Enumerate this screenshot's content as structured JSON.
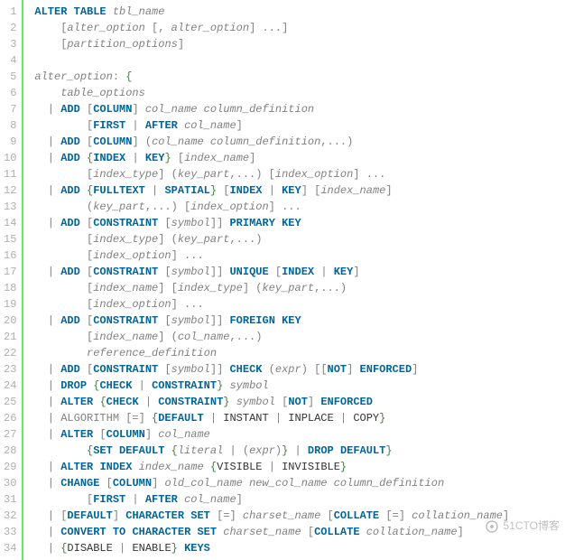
{
  "watermark": "51CTO博客",
  "lines": {
    "l1": [
      [
        "kw",
        "ALTER"
      ],
      [
        "p",
        " "
      ],
      [
        "kw",
        "TABLE"
      ],
      [
        "p",
        " "
      ],
      [
        "ar",
        "tbl_name"
      ]
    ],
    "l2": [
      [
        "p",
        "    ["
      ],
      [
        "ar",
        "alter_option"
      ],
      [
        "p",
        " [, "
      ],
      [
        "ar",
        "alter_option"
      ],
      [
        "p",
        "] ...]"
      ]
    ],
    "l3": [
      [
        "p",
        "    ["
      ],
      [
        "ar",
        "partition_options"
      ],
      [
        "p",
        "]"
      ]
    ],
    "l4": [
      [
        "p",
        ""
      ]
    ],
    "l5": [
      [
        "ar",
        "alter_option"
      ],
      [
        "p",
        ": "
      ],
      [
        "g",
        "{"
      ]
    ],
    "l6": [
      [
        "p",
        "    "
      ],
      [
        "ar",
        "table_options"
      ]
    ],
    "l7": [
      [
        "p",
        "  | "
      ],
      [
        "kw",
        "ADD"
      ],
      [
        "p",
        " ["
      ],
      [
        "kw",
        "COLUMN"
      ],
      [
        "p",
        "] "
      ],
      [
        "ar",
        "col_name"
      ],
      [
        "p",
        " "
      ],
      [
        "ar",
        "column_definition"
      ]
    ],
    "l8": [
      [
        "p",
        "        ["
      ],
      [
        "kw",
        "FIRST"
      ],
      [
        "p",
        " | "
      ],
      [
        "kw",
        "AFTER"
      ],
      [
        "p",
        " "
      ],
      [
        "ar",
        "col_name"
      ],
      [
        "p",
        "]"
      ]
    ],
    "l9": [
      [
        "p",
        "  | "
      ],
      [
        "kw",
        "ADD"
      ],
      [
        "p",
        " ["
      ],
      [
        "kw",
        "COLUMN"
      ],
      [
        "p",
        "] ("
      ],
      [
        "ar",
        "col_name"
      ],
      [
        "p",
        " "
      ],
      [
        "ar",
        "column_definition"
      ],
      [
        "p",
        ",...)"
      ]
    ],
    "l10": [
      [
        "p",
        "  | "
      ],
      [
        "kw",
        "ADD"
      ],
      [
        "p",
        " "
      ],
      [
        "g",
        "{"
      ],
      [
        "kw",
        "INDEX"
      ],
      [
        "p",
        " | "
      ],
      [
        "kw",
        "KEY"
      ],
      [
        "g",
        "}"
      ],
      [
        "p",
        " ["
      ],
      [
        "ar",
        "index_name"
      ],
      [
        "p",
        "]"
      ]
    ],
    "l11": [
      [
        "p",
        "        ["
      ],
      [
        "ar",
        "index_type"
      ],
      [
        "p",
        "] ("
      ],
      [
        "ar",
        "key_part"
      ],
      [
        "p",
        ",...) ["
      ],
      [
        "ar",
        "index_option"
      ],
      [
        "p",
        "] ..."
      ]
    ],
    "l12": [
      [
        "p",
        "  | "
      ],
      [
        "kw",
        "ADD"
      ],
      [
        "p",
        " "
      ],
      [
        "g",
        "{"
      ],
      [
        "kw",
        "FULLTEXT"
      ],
      [
        "p",
        " | "
      ],
      [
        "kw",
        "SPATIAL"
      ],
      [
        "g",
        "}"
      ],
      [
        "p",
        " ["
      ],
      [
        "kw",
        "INDEX"
      ],
      [
        "p",
        " | "
      ],
      [
        "kw",
        "KEY"
      ],
      [
        "p",
        "] ["
      ],
      [
        "ar",
        "index_name"
      ],
      [
        "p",
        "]"
      ]
    ],
    "l13": [
      [
        "p",
        "        ("
      ],
      [
        "ar",
        "key_part"
      ],
      [
        "p",
        ",...) ["
      ],
      [
        "ar",
        "index_option"
      ],
      [
        "p",
        "] ..."
      ]
    ],
    "l14": [
      [
        "p",
        "  | "
      ],
      [
        "kw",
        "ADD"
      ],
      [
        "p",
        " ["
      ],
      [
        "kw",
        "CONSTRAINT"
      ],
      [
        "p",
        " ["
      ],
      [
        "ar",
        "symbol"
      ],
      [
        "p",
        "]] "
      ],
      [
        "kw",
        "PRIMARY"
      ],
      [
        "p",
        " "
      ],
      [
        "kw",
        "KEY"
      ]
    ],
    "l15": [
      [
        "p",
        "        ["
      ],
      [
        "ar",
        "index_type"
      ],
      [
        "p",
        "] ("
      ],
      [
        "ar",
        "key_part"
      ],
      [
        "p",
        ",...)"
      ]
    ],
    "l16": [
      [
        "p",
        "        ["
      ],
      [
        "ar",
        "index_option"
      ],
      [
        "p",
        "] ..."
      ]
    ],
    "l17": [
      [
        "p",
        "  | "
      ],
      [
        "kw",
        "ADD"
      ],
      [
        "p",
        " ["
      ],
      [
        "kw",
        "CONSTRAINT"
      ],
      [
        "p",
        " ["
      ],
      [
        "ar",
        "symbol"
      ],
      [
        "p",
        "]] "
      ],
      [
        "kw",
        "UNIQUE"
      ],
      [
        "p",
        " ["
      ],
      [
        "kw",
        "INDEX"
      ],
      [
        "p",
        " | "
      ],
      [
        "kw",
        "KEY"
      ],
      [
        "p",
        "]"
      ]
    ],
    "l18": [
      [
        "p",
        "        ["
      ],
      [
        "ar",
        "index_name"
      ],
      [
        "p",
        "] ["
      ],
      [
        "ar",
        "index_type"
      ],
      [
        "p",
        "] ("
      ],
      [
        "ar",
        "key_part"
      ],
      [
        "p",
        ",...)"
      ]
    ],
    "l19": [
      [
        "p",
        "        ["
      ],
      [
        "ar",
        "index_option"
      ],
      [
        "p",
        "] ..."
      ]
    ],
    "l20": [
      [
        "p",
        "  | "
      ],
      [
        "kw",
        "ADD"
      ],
      [
        "p",
        " ["
      ],
      [
        "kw",
        "CONSTRAINT"
      ],
      [
        "p",
        " ["
      ],
      [
        "ar",
        "symbol"
      ],
      [
        "p",
        "]] "
      ],
      [
        "kw",
        "FOREIGN"
      ],
      [
        "p",
        " "
      ],
      [
        "kw",
        "KEY"
      ]
    ],
    "l21": [
      [
        "p",
        "        ["
      ],
      [
        "ar",
        "index_name"
      ],
      [
        "p",
        "] ("
      ],
      [
        "ar",
        "col_name"
      ],
      [
        "p",
        ",...)"
      ]
    ],
    "l22": [
      [
        "p",
        "        "
      ],
      [
        "ar",
        "reference_definition"
      ]
    ],
    "l23": [
      [
        "p",
        "  | "
      ],
      [
        "kw",
        "ADD"
      ],
      [
        "p",
        " ["
      ],
      [
        "kw",
        "CONSTRAINT"
      ],
      [
        "p",
        " ["
      ],
      [
        "ar",
        "symbol"
      ],
      [
        "p",
        "]] "
      ],
      [
        "kw",
        "CHECK"
      ],
      [
        "p",
        " ("
      ],
      [
        "ar",
        "expr"
      ],
      [
        "p",
        ") [["
      ],
      [
        "kw",
        "NOT"
      ],
      [
        "p",
        "] "
      ],
      [
        "kw",
        "ENFORCED"
      ],
      [
        "p",
        "]"
      ]
    ],
    "l24": [
      [
        "p",
        "  | "
      ],
      [
        "kw",
        "DROP"
      ],
      [
        "p",
        " "
      ],
      [
        "g",
        "{"
      ],
      [
        "kw",
        "CHECK"
      ],
      [
        "p",
        " | "
      ],
      [
        "kw",
        "CONSTRAINT"
      ],
      [
        "g",
        "}"
      ],
      [
        "p",
        " "
      ],
      [
        "ar",
        "symbol"
      ]
    ],
    "l25": [
      [
        "p",
        "  | "
      ],
      [
        "kw",
        "ALTER"
      ],
      [
        "p",
        " "
      ],
      [
        "g",
        "{"
      ],
      [
        "kw",
        "CHECK"
      ],
      [
        "p",
        " | "
      ],
      [
        "kw",
        "CONSTRAINT"
      ],
      [
        "g",
        "}"
      ],
      [
        "p",
        " "
      ],
      [
        "ar",
        "symbol"
      ],
      [
        "p",
        " ["
      ],
      [
        "kw",
        "NOT"
      ],
      [
        "p",
        "] "
      ],
      [
        "kw",
        "ENFORCED"
      ]
    ],
    "l26": [
      [
        "p",
        "  | ALGORITHM [=] "
      ],
      [
        "g",
        "{"
      ],
      [
        "kw",
        "DEFAULT"
      ],
      [
        "p",
        " | "
      ],
      [
        "k2",
        "INSTANT"
      ],
      [
        "p",
        " | "
      ],
      [
        "k2",
        "INPLACE"
      ],
      [
        "p",
        " | "
      ],
      [
        "k2",
        "COPY"
      ],
      [
        "g",
        "}"
      ]
    ],
    "l27": [
      [
        "p",
        "  | "
      ],
      [
        "kw",
        "ALTER"
      ],
      [
        "p",
        " ["
      ],
      [
        "kw",
        "COLUMN"
      ],
      [
        "p",
        "] "
      ],
      [
        "ar",
        "col_name"
      ]
    ],
    "l28": [
      [
        "p",
        "        "
      ],
      [
        "g",
        "{"
      ],
      [
        "kw",
        "SET"
      ],
      [
        "p",
        " "
      ],
      [
        "kw",
        "DEFAULT"
      ],
      [
        "p",
        " "
      ],
      [
        "g",
        "{"
      ],
      [
        "ar",
        "literal"
      ],
      [
        "p",
        " | ("
      ],
      [
        "ar",
        "expr"
      ],
      [
        "p",
        ")"
      ],
      [
        "g",
        "}"
      ],
      [
        "p",
        " | "
      ],
      [
        "kw",
        "DROP"
      ],
      [
        "p",
        " "
      ],
      [
        "kw",
        "DEFAULT"
      ],
      [
        "g",
        "}"
      ]
    ],
    "l29": [
      [
        "p",
        "  | "
      ],
      [
        "kw",
        "ALTER"
      ],
      [
        "p",
        " "
      ],
      [
        "kw",
        "INDEX"
      ],
      [
        "p",
        " "
      ],
      [
        "ar",
        "index_name"
      ],
      [
        "p",
        " "
      ],
      [
        "g",
        "{"
      ],
      [
        "k2",
        "VISIBLE"
      ],
      [
        "p",
        " | "
      ],
      [
        "k2",
        "INVISIBLE"
      ],
      [
        "g",
        "}"
      ]
    ],
    "l30": [
      [
        "p",
        "  | "
      ],
      [
        "kw",
        "CHANGE"
      ],
      [
        "p",
        " ["
      ],
      [
        "kw",
        "COLUMN"
      ],
      [
        "p",
        "] "
      ],
      [
        "ar",
        "old_col_name"
      ],
      [
        "p",
        " "
      ],
      [
        "ar",
        "new_col_name"
      ],
      [
        "p",
        " "
      ],
      [
        "ar",
        "column_definition"
      ]
    ],
    "l31": [
      [
        "p",
        "        ["
      ],
      [
        "kw",
        "FIRST"
      ],
      [
        "p",
        " | "
      ],
      [
        "kw",
        "AFTER"
      ],
      [
        "p",
        " "
      ],
      [
        "ar",
        "col_name"
      ],
      [
        "p",
        "]"
      ]
    ],
    "l32": [
      [
        "p",
        "  | ["
      ],
      [
        "kw",
        "DEFAULT"
      ],
      [
        "p",
        "] "
      ],
      [
        "kw",
        "CHARACTER"
      ],
      [
        "p",
        " "
      ],
      [
        "kw",
        "SET"
      ],
      [
        "p",
        " [=] "
      ],
      [
        "ar",
        "charset_name"
      ],
      [
        "p",
        " ["
      ],
      [
        "kw",
        "COLLATE"
      ],
      [
        "p",
        " [=] "
      ],
      [
        "ar",
        "collation_name"
      ],
      [
        "p",
        "]"
      ]
    ],
    "l33": [
      [
        "p",
        "  | "
      ],
      [
        "kw",
        "CONVERT"
      ],
      [
        "p",
        " "
      ],
      [
        "kw",
        "TO"
      ],
      [
        "p",
        " "
      ],
      [
        "kw",
        "CHARACTER"
      ],
      [
        "p",
        " "
      ],
      [
        "kw",
        "SET"
      ],
      [
        "p",
        " "
      ],
      [
        "ar",
        "charset_name"
      ],
      [
        "p",
        " ["
      ],
      [
        "kw",
        "COLLATE"
      ],
      [
        "p",
        " "
      ],
      [
        "ar",
        "collation_name"
      ],
      [
        "p",
        "]"
      ]
    ],
    "l34": [
      [
        "p",
        "  | "
      ],
      [
        "g",
        "{"
      ],
      [
        "k2",
        "DISABLE"
      ],
      [
        "p",
        " | "
      ],
      [
        "k2",
        "ENABLE"
      ],
      [
        "g",
        "}"
      ],
      [
        "p",
        " "
      ],
      [
        "kw",
        "KEYS"
      ]
    ]
  },
  "lineCount": 34
}
